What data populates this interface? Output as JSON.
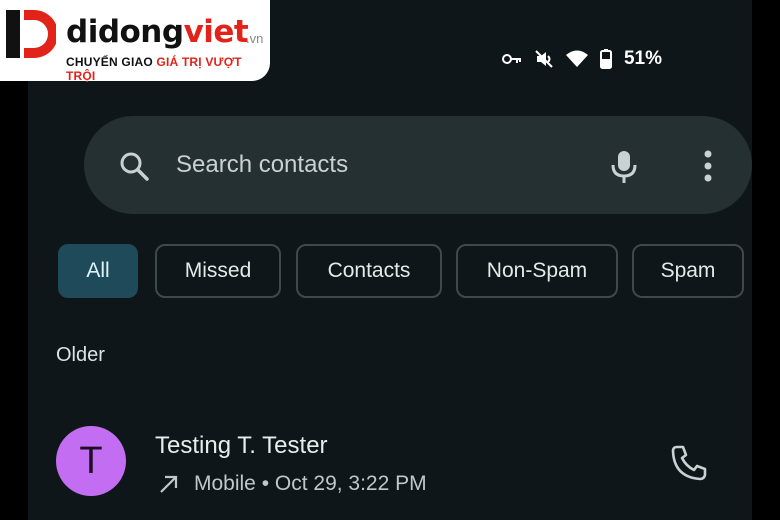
{
  "watermark": {
    "name_part1": "didong",
    "name_part2": "viet",
    "domain": ".vn",
    "tagline_part1": "CHUYỂN GIAO",
    "tagline_part2": "GIÁ TRỊ VƯỢT TRỘI"
  },
  "status_bar": {
    "battery_percent": "51%",
    "icons": [
      "key-icon",
      "mute-icon",
      "wifi-icon",
      "battery-icon"
    ]
  },
  "search": {
    "placeholder": "Search contacts",
    "value": ""
  },
  "filters": {
    "chips": [
      {
        "label": "All",
        "selected": true
      },
      {
        "label": "Missed",
        "selected": false
      },
      {
        "label": "Contacts",
        "selected": false
      },
      {
        "label": "Non-Spam",
        "selected": false
      },
      {
        "label": "Spam",
        "selected": false
      }
    ]
  },
  "section": {
    "header": "Older"
  },
  "call_log": [
    {
      "avatar_initial": "T",
      "name": "Testing T. Tester",
      "call_type": "outgoing",
      "detail": "Mobile • Oct 29, 3:22 PM"
    }
  ],
  "colors": {
    "background": "#0f1619",
    "search_bg": "#253033",
    "chip_active": "#1f4a5a",
    "avatar": "#c36df2",
    "brand_red": "#e2231a"
  }
}
